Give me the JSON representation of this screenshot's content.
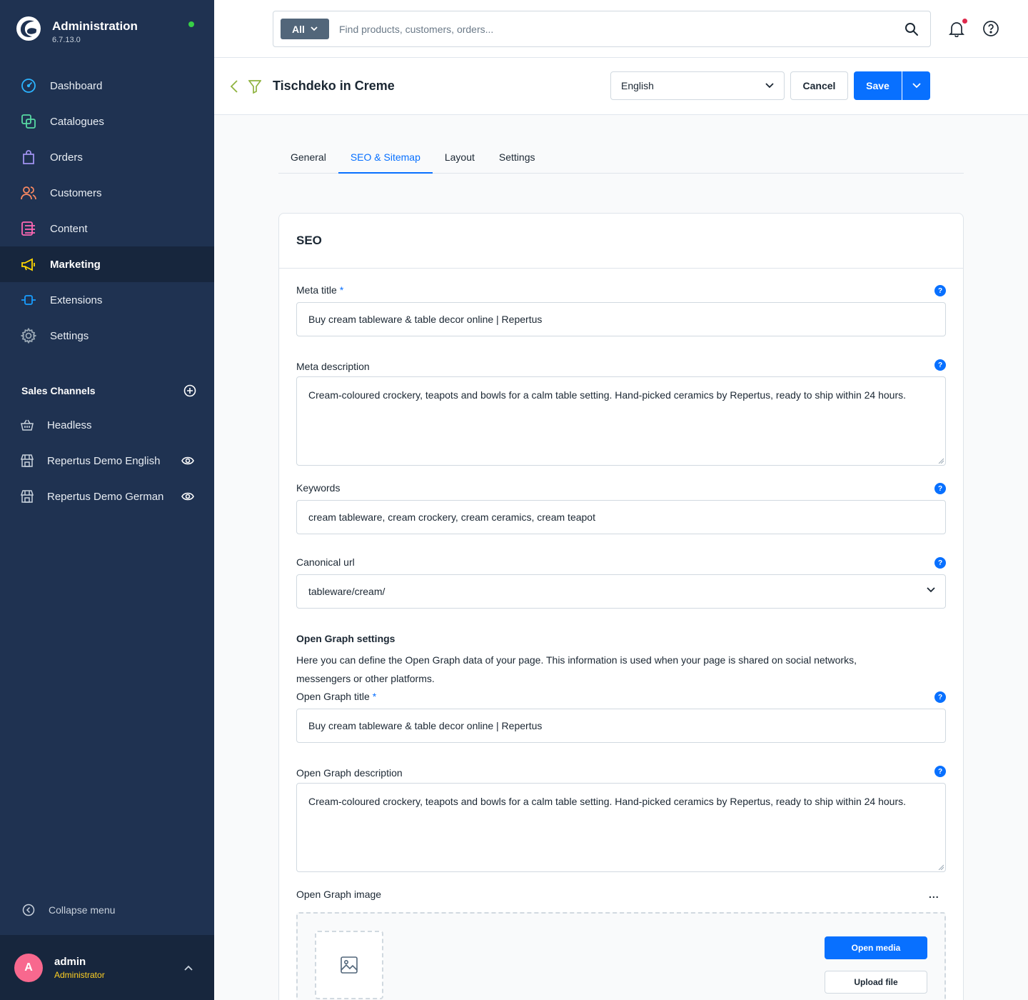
{
  "app": {
    "title": "Administration",
    "version": "6.7.13.0"
  },
  "nav": {
    "items": [
      {
        "label": "Dashboard",
        "icon": "dashboard-icon",
        "color": "#2bb3ff"
      },
      {
        "label": "Catalogues",
        "icon": "catalogues-icon",
        "color": "#57d9a3"
      },
      {
        "label": "Orders",
        "icon": "orders-icon",
        "color": "#a092f0"
      },
      {
        "label": "Customers",
        "icon": "customers-icon",
        "color": "#f88962"
      },
      {
        "label": "Content",
        "icon": "content-icon",
        "color": "#ff68b4"
      },
      {
        "label": "Marketing",
        "icon": "marketing-icon",
        "color": "#ffd700"
      },
      {
        "label": "Extensions",
        "icon": "extensions-icon",
        "color": "#189eff"
      },
      {
        "label": "Settings",
        "icon": "settings-icon",
        "color": "#9aa8b5"
      }
    ],
    "active_index": 5
  },
  "sales_channels": {
    "title": "Sales Channels",
    "items": [
      {
        "label": "Headless"
      },
      {
        "label": "Repertus Demo English"
      },
      {
        "label": "Repertus Demo German"
      }
    ]
  },
  "collapse_label": "Collapse menu",
  "user": {
    "initial": "A",
    "name": "admin",
    "role": "Administrator"
  },
  "search": {
    "type": "All",
    "placeholder": "Find products, customers, orders..."
  },
  "smartbar": {
    "title": "Tischdeko in Creme",
    "language": "English",
    "cancel": "Cancel",
    "save": "Save"
  },
  "tabs": [
    {
      "label": "General"
    },
    {
      "label": "SEO & Sitemap"
    },
    {
      "label": "Layout"
    },
    {
      "label": "Settings"
    }
  ],
  "active_tab": 1,
  "seo": {
    "card_title": "SEO",
    "meta_title": {
      "label": "Meta title",
      "required": "*",
      "value": "Buy cream tableware & table decor online | Repertus"
    },
    "meta_description": {
      "label": "Meta description",
      "value": "Cream-coloured crockery, teapots and bowls for a calm table setting. Hand-picked ceramics by Repertus, ready to ship within 24 hours."
    },
    "keywords": {
      "label": "Keywords",
      "value": "cream tableware, cream crockery, cream ceramics, cream teapot"
    },
    "canonical": {
      "label": "Canonical url",
      "value": "tableware/cream/"
    },
    "og": {
      "heading": "Open Graph settings",
      "description": "Here you can define the Open Graph data of your page. This information is used when your page is shared on social networks, messengers or other platforms.",
      "title": {
        "label": "Open Graph title",
        "required": "*",
        "value": "Buy cream tableware & table decor online | Repertus"
      },
      "desc_field": {
        "label": "Open Graph description",
        "value": "Cream-coloured crockery, teapots and bowls for a calm table setting. Hand-picked ceramics by Repertus, ready to ship within 24 hours."
      },
      "image": {
        "label": "Open Graph image",
        "more": "...",
        "open_media": "Open media",
        "upload": "Upload file"
      }
    },
    "help_glyph": "?"
  },
  "colors": {
    "sidebar": "#1f3251",
    "accent": "#0870ff",
    "status_online": "#37d046",
    "notification_dot": "#de294c",
    "avatar": "#f8688e",
    "role": "#ffd023"
  }
}
